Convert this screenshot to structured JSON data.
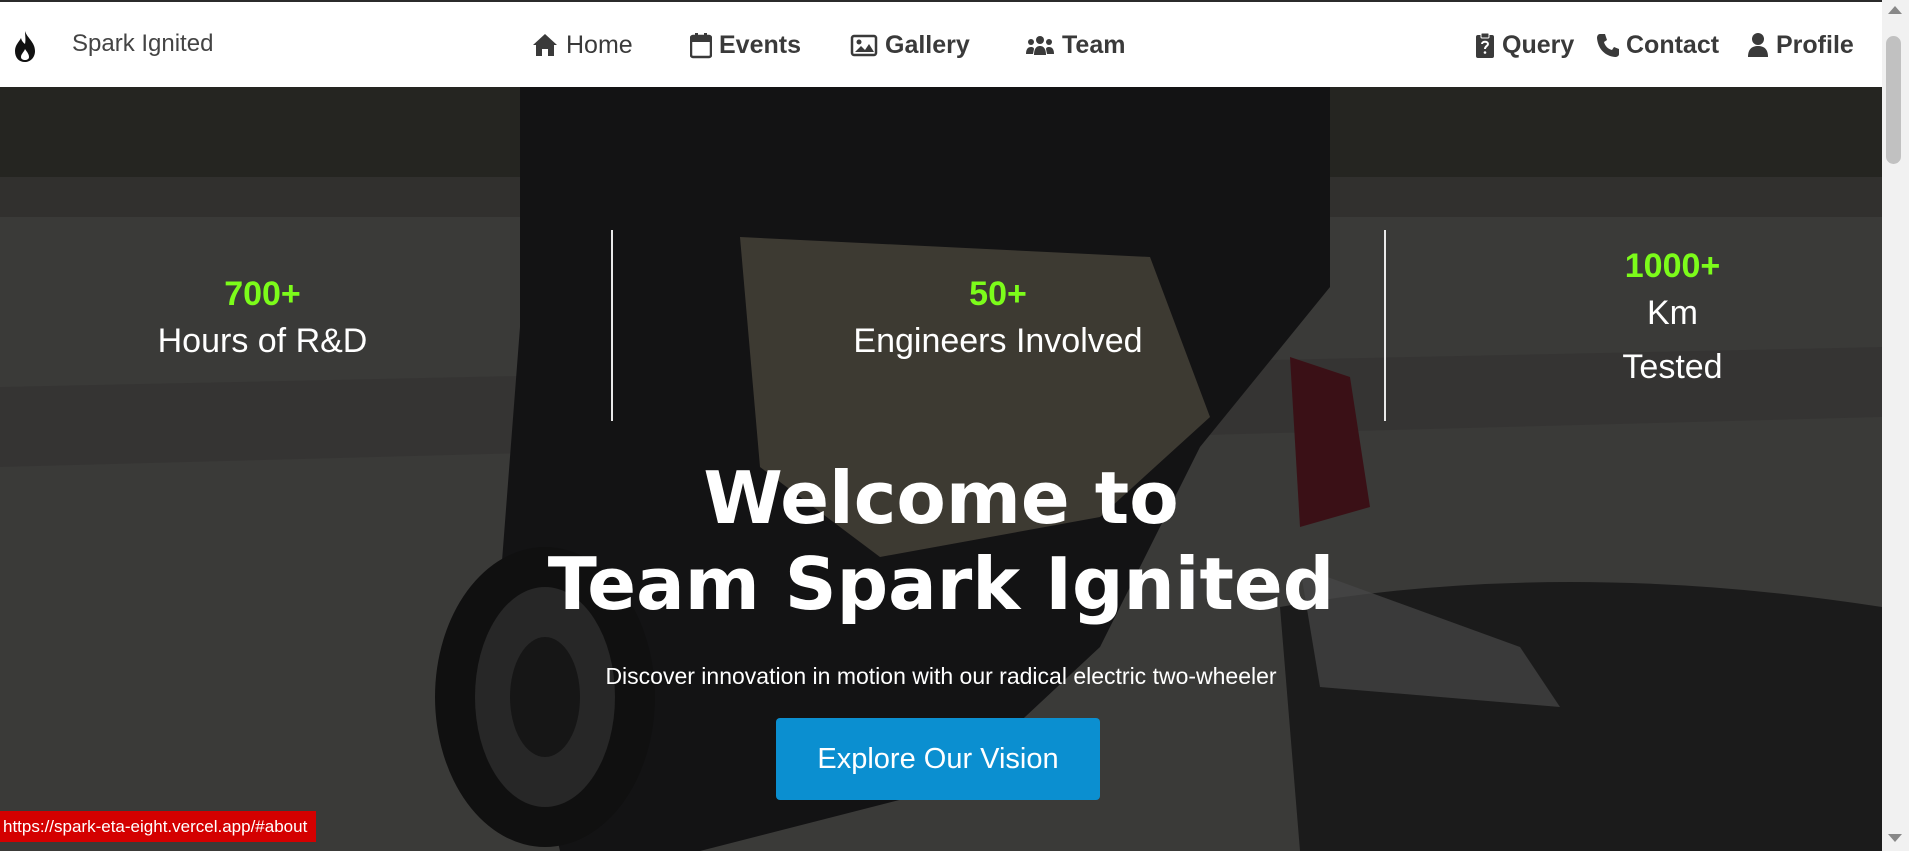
{
  "brand": {
    "name": "Spark Ignited",
    "icon": "flame-icon"
  },
  "nav": {
    "home": "Home",
    "events": "Events",
    "gallery": "Gallery",
    "team": "Team",
    "query": "Query",
    "contact": "Contact",
    "profile": "Profile"
  },
  "stats": [
    {
      "value": "700+",
      "label": "Hours of R&D"
    },
    {
      "value": "50+",
      "label": "Engineers Involved"
    },
    {
      "value": "1000+",
      "label_line1": "Km",
      "label_line2": "Tested"
    }
  ],
  "hero": {
    "title_line1": "Welcome to",
    "title_line2": "Team Spark Ignited",
    "subtitle": "Discover innovation in motion with our radical electric two-wheeler",
    "cta": "Explore Our Vision"
  },
  "status_bar": {
    "url": "https://spark-eta-eight.vercel.app/#about"
  },
  "colors": {
    "accent": "#7cfc1a",
    "button": "#0b8fd0",
    "status": "#d40000"
  }
}
